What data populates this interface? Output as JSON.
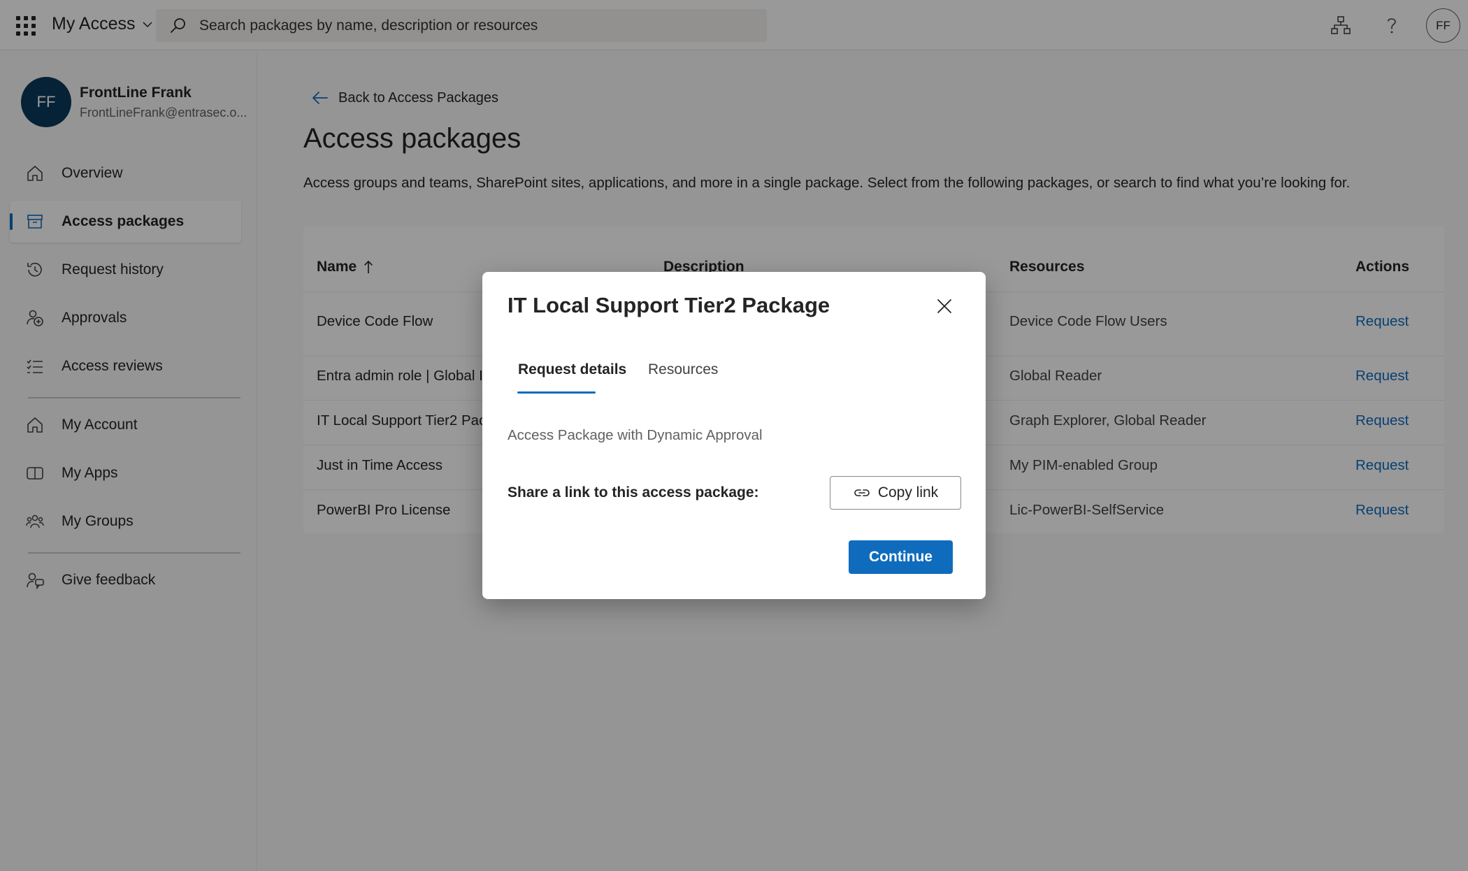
{
  "topbar": {
    "app_title": "My Access",
    "search_placeholder": "Search packages by name, description or resources",
    "user_initials": "FF"
  },
  "sidebar": {
    "user": {
      "initials": "FF",
      "name": "FrontLine Frank",
      "email": "FrontLineFrank@entrasec.o..."
    },
    "items": [
      {
        "label": "Overview",
        "icon": "home-icon"
      },
      {
        "label": "Access packages",
        "icon": "package-icon",
        "active": true
      },
      {
        "label": "Request history",
        "icon": "history-icon"
      },
      {
        "label": "Approvals",
        "icon": "approvals-icon"
      },
      {
        "label": "Access reviews",
        "icon": "checklist-icon"
      }
    ],
    "secondary_items": [
      {
        "label": "My Account",
        "icon": "home-icon"
      },
      {
        "label": "My Apps",
        "icon": "apps-icon"
      },
      {
        "label": "My Groups",
        "icon": "groups-icon"
      }
    ],
    "feedback": {
      "label": "Give feedback",
      "icon": "feedback-icon"
    }
  },
  "main": {
    "back_link": "Back to Access Packages",
    "title": "Access packages",
    "description": "Access groups and teams, SharePoint sites, applications, and more in a single package. Select from the following packages, or search to find what you’re looking for.",
    "table": {
      "headers": {
        "name": "Name",
        "description": "Description",
        "resources": "Resources",
        "actions": "Actions"
      },
      "rows": [
        {
          "name": "Device Code Flow",
          "resources": "Device Code Flow Users",
          "action": "Request"
        },
        {
          "name": "Entra admin role | Global I",
          "resources": "Global Reader",
          "action": "Request"
        },
        {
          "name": "IT Local Support Tier2 Pac",
          "resources": "Graph Explorer, Global Reader",
          "action": "Request"
        },
        {
          "name": "Just in Time Access",
          "resources": "My PIM-enabled Group",
          "action": "Request"
        },
        {
          "name": "PowerBI Pro License",
          "resources": "Lic-PowerBI-SelfService",
          "action": "Request"
        }
      ]
    }
  },
  "dialog": {
    "title": "IT Local Support Tier2 Package",
    "tabs": [
      "Request details",
      "Resources"
    ],
    "description": "Access Package with Dynamic Approval",
    "share_label": "Share a link to this access package:",
    "copy_link": "Copy link",
    "continue": "Continue"
  },
  "colors": {
    "accent": "#0f6cbd",
    "avatar_bg": "#0b3a5b"
  }
}
